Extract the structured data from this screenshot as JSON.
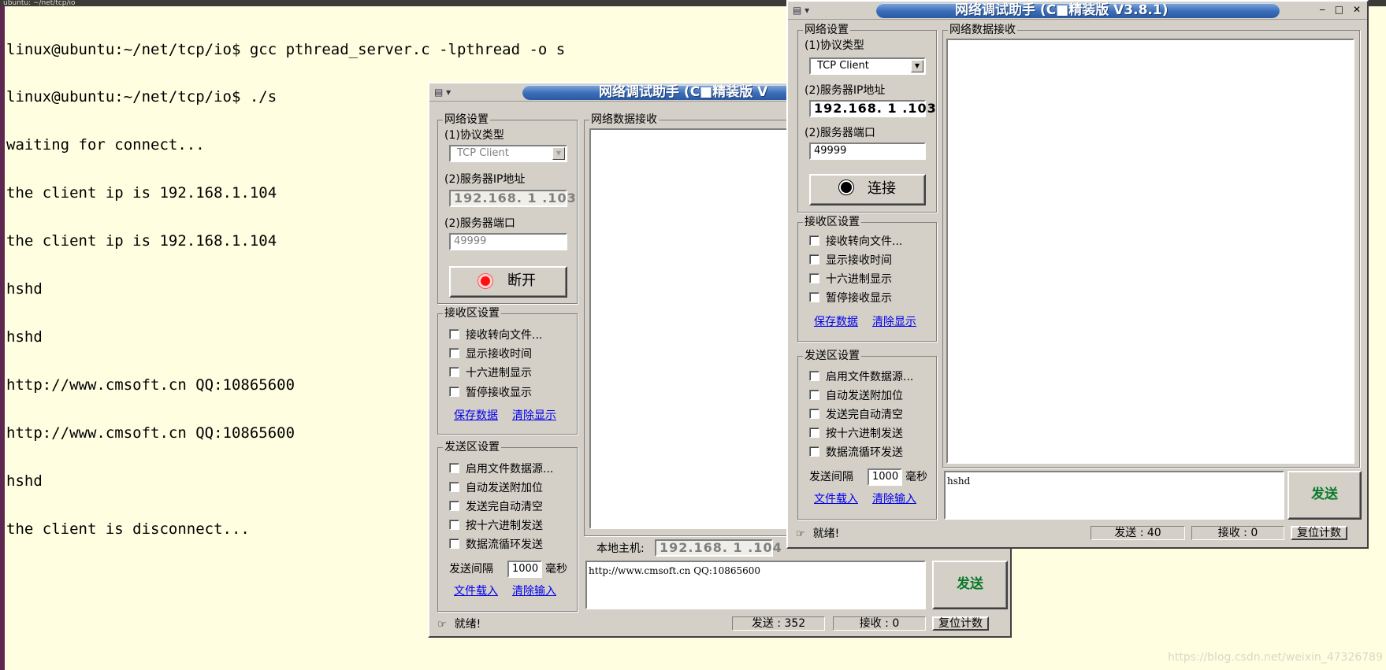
{
  "terminal": {
    "title": "ubuntu: ~/net/tcp/io",
    "lines": [
      "linux@ubuntu:~/net/tcp/io$ gcc pthread_server.c -lpthread -o s",
      "linux@ubuntu:~/net/tcp/io$ ./s",
      "waiting for connect...",
      "the client ip is 192.168.1.104",
      "the client ip is 192.168.1.104",
      "hshd",
      "hshd",
      "http://www.cmsoft.cn QQ:10865600",
      "http://www.cmsoft.cn QQ:10865600",
      "hshd",
      "the client is disconnect..."
    ]
  },
  "watermark": "https://blog.csdn.net/weixin_47326789",
  "colors": {
    "terminal_bg": "#fffee0",
    "title_bar": "#3a6cb8",
    "send_button": "#0a7a2a",
    "led": "#ff1010"
  },
  "win_a": {
    "title": "网络调试助手 (C■精装版 V",
    "net_settings": "网络设置",
    "protocol_label": "(1)协议类型",
    "protocol_value": "TCP Client",
    "ip_label": "(2)服务器IP地址",
    "ip_value": "192.168. 1 .103",
    "port_label": "(2)服务器端口",
    "port_value": "49999",
    "connect_button": "断开",
    "recv_settings": "接收区设置",
    "recv_options": [
      "接收转向文件...",
      "显示接收时间",
      "十六进制显示",
      "暂停接收显示"
    ],
    "save_data": "保存数据",
    "clear_display": "清除显示",
    "send_settings": "发送区设置",
    "send_options": [
      "启用文件数据源...",
      "自动发送附加位",
      "发送完自动清空",
      "按十六进制发送",
      "数据流循环发送"
    ],
    "interval_label": "发送间隔",
    "interval_value": "1000",
    "interval_unit": "毫秒",
    "file_load": "文件载入",
    "clear_input": "清除输入",
    "recv_area_label": "网络数据接收",
    "local_host_label": "本地主机:",
    "local_host_value": "192.168. 1 .104",
    "send_text": "http://www.cmsoft.cn QQ:10865600",
    "send_button": "发送",
    "status": "就绪!",
    "sent_count": "发送 : 352",
    "recv_count": "接收 : 0",
    "reset_count": "复位计数"
  },
  "win_b": {
    "title": "网络调试助手 (C■精装版 V3.8.1)",
    "net_settings": "网络设置",
    "protocol_label": "(1)协议类型",
    "protocol_value": "TCP Client",
    "ip_label": "(2)服务器IP地址",
    "ip_value": "192.168. 1 .103",
    "port_label": "(2)服务器端口",
    "port_value": "49999",
    "connect_button": "连接",
    "recv_settings": "接收区设置",
    "recv_options": [
      "接收转向文件...",
      "显示接收时间",
      "十六进制显示",
      "暂停接收显示"
    ],
    "save_data": "保存数据",
    "clear_display": "清除显示",
    "send_settings": "发送区设置",
    "send_options": [
      "启用文件数据源...",
      "自动发送附加位",
      "发送完自动清空",
      "按十六进制发送",
      "数据流循环发送"
    ],
    "interval_label": "发送间隔",
    "interval_value": "1000",
    "interval_unit": "毫秒",
    "file_load": "文件载入",
    "clear_input": "清除输入",
    "recv_area_label": "网络数据接收",
    "send_text": "hshd",
    "send_button": "发送",
    "status": "就绪!",
    "sent_count": "发送 : 40",
    "recv_count": "接收 : 0",
    "reset_count": "复位计数"
  }
}
